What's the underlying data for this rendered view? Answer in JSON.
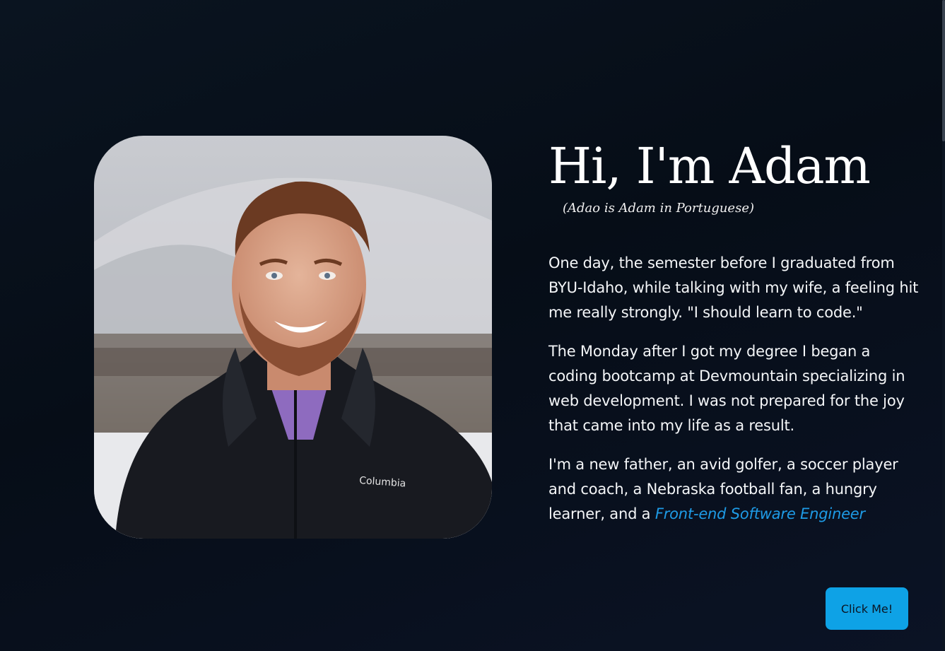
{
  "hero": {
    "title": "Hi, I'm Adam",
    "subtitle": "(Adao is Adam in Portuguese)"
  },
  "bio": {
    "p1": "One day, the semester before I graduated from BYU-Idaho, while talking with my wife, a feeling hit me really strongly. \"I should learn to code.\"",
    "p2": "The Monday after I got my degree I began a coding bootcamp at Devmountain specializing in web development. I was not prepared for the joy that came into my life as a result.",
    "p3_prefix": "I'm a new father, an avid golfer, a soccer player and coach, a Nebraska football fan, a hungry learner, and a ",
    "p3_link": "Front-end Software Engineer"
  },
  "photo": {
    "jacket_brand": "Columbia"
  },
  "cta": {
    "label": "Click Me!"
  },
  "colors": {
    "background": "#070e18",
    "link": "#1e9be6",
    "button": "#0ea2e6"
  }
}
